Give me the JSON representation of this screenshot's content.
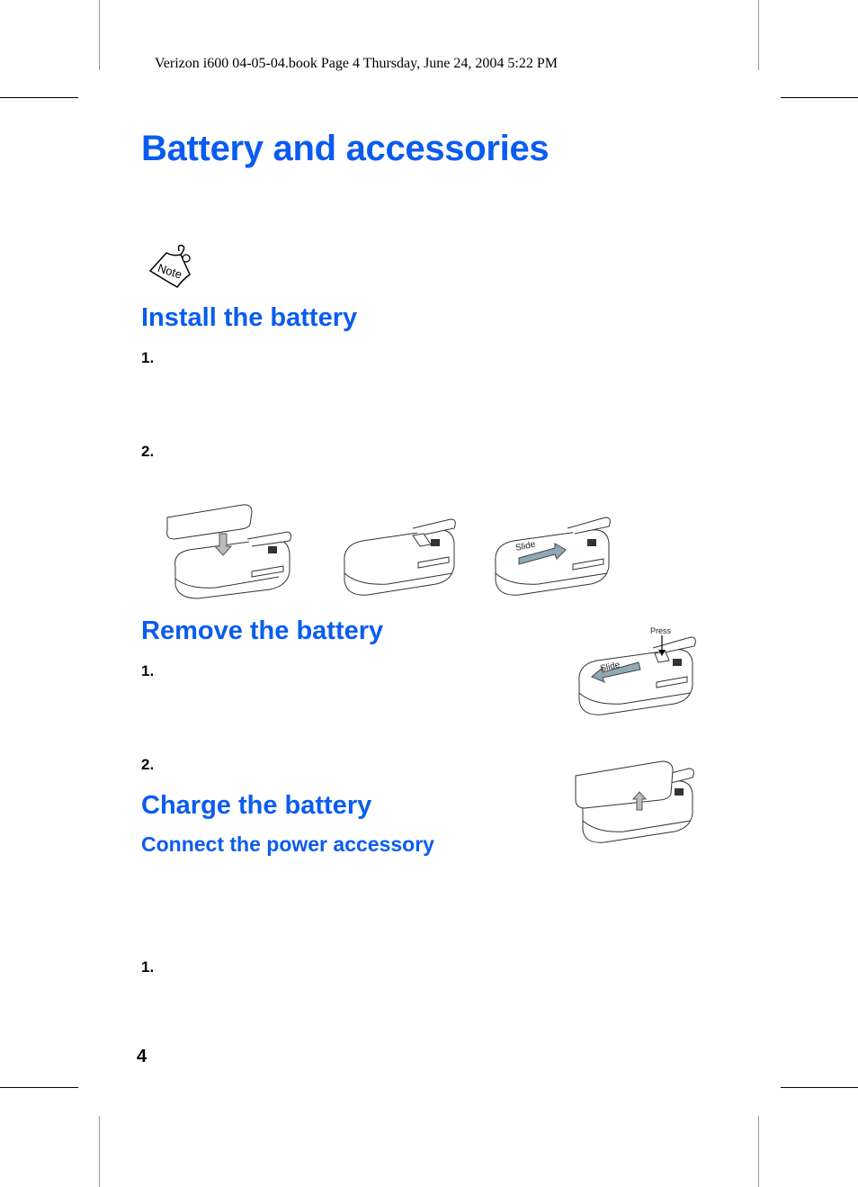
{
  "header": {
    "book_info": "Verizon i600 04-05-04.book  Page 4  Thursday, June 24, 2004  5:22 PM"
  },
  "page": {
    "title": "Battery and accessories",
    "note_icon_label": "Note",
    "page_number": "4"
  },
  "sections": {
    "install": {
      "heading": "Install the battery",
      "steps": [
        "1.",
        "2."
      ],
      "illustrations": [
        {
          "name": "battery-lower-illustration",
          "label": ""
        },
        {
          "name": "battery-seated-illustration",
          "label": ""
        },
        {
          "name": "battery-slide-lock-illustration",
          "label": "Slide"
        }
      ]
    },
    "remove": {
      "heading": "Remove the battery",
      "steps": [
        "1.",
        "2."
      ],
      "illustrations": [
        {
          "name": "battery-press-slide-illustration",
          "press_label": "Press",
          "slide_label": "Slide"
        },
        {
          "name": "battery-lift-illustration",
          "label": ""
        }
      ]
    },
    "charge": {
      "heading": "Charge the battery",
      "subheading": "Connect the power accessory",
      "steps": [
        "1."
      ]
    }
  },
  "colors": {
    "heading_blue": "#0a5cf0",
    "text": "#000000"
  }
}
